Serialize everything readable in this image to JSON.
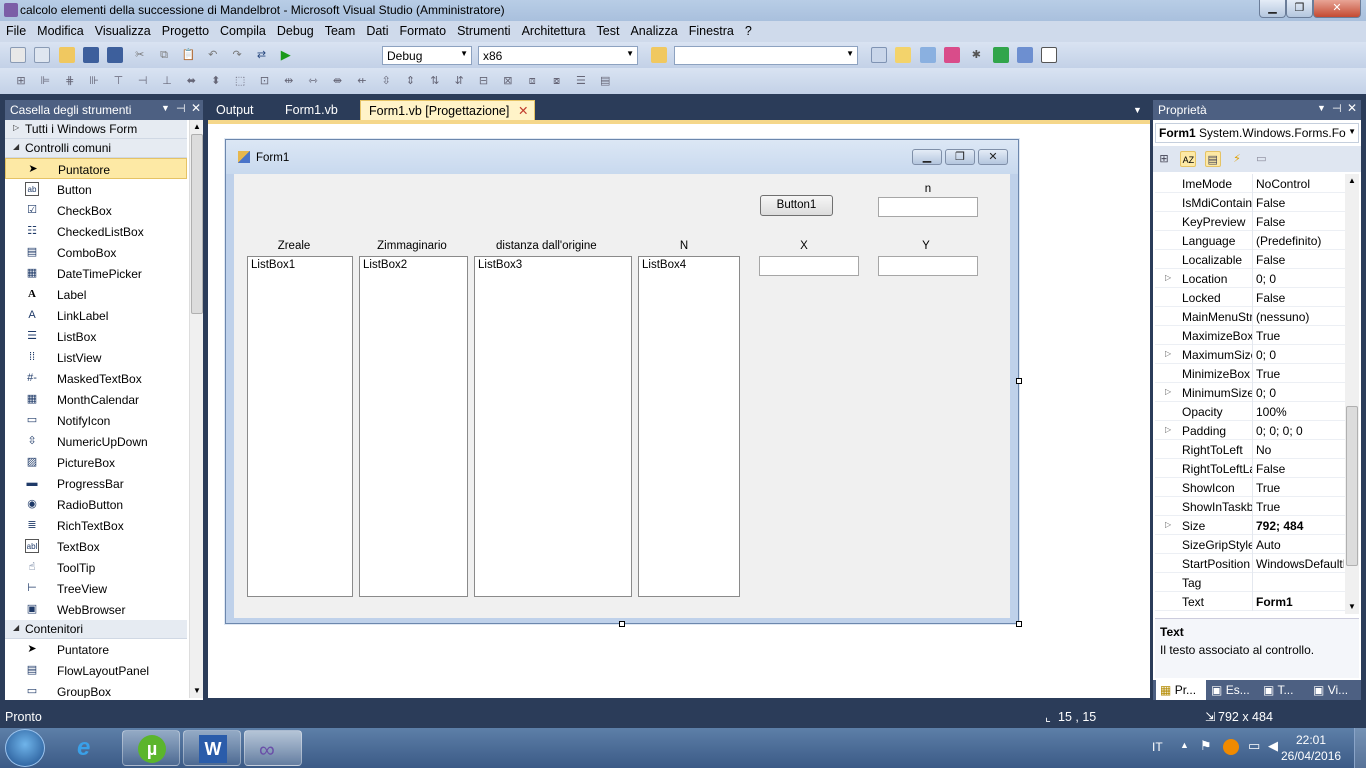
{
  "window": {
    "title": "calcolo elementi della successione di Mandelbrot - Microsoft Visual Studio (Amministratore)"
  },
  "menu": [
    "File",
    "Modifica",
    "Visualizza",
    "Progetto",
    "Compila",
    "Debug",
    "Team",
    "Dati",
    "Formato",
    "Strumenti",
    "Architettura",
    "Test",
    "Analizza",
    "Finestra",
    "?"
  ],
  "toolbar": {
    "config": "Debug",
    "platform": "x86",
    "find": ""
  },
  "toolbox": {
    "title": "Casella degli strumenti",
    "all_forms": "Tutti i Windows Form",
    "common": "Controlli comuni",
    "items": [
      {
        "label": "Puntatore",
        "icon": "pointer-icon"
      },
      {
        "label": "Button",
        "icon": "button-icon"
      },
      {
        "label": "CheckBox",
        "icon": "checkbox-icon"
      },
      {
        "label": "CheckedListBox",
        "icon": "checkedlistbox-icon"
      },
      {
        "label": "ComboBox",
        "icon": "combobox-icon"
      },
      {
        "label": "DateTimePicker",
        "icon": "datetimepicker-icon"
      },
      {
        "label": "Label",
        "icon": "label-icon"
      },
      {
        "label": "LinkLabel",
        "icon": "linklabel-icon"
      },
      {
        "label": "ListBox",
        "icon": "listbox-icon"
      },
      {
        "label": "ListView",
        "icon": "listview-icon"
      },
      {
        "label": "MaskedTextBox",
        "icon": "maskedtextbox-icon"
      },
      {
        "label": "MonthCalendar",
        "icon": "monthcalendar-icon"
      },
      {
        "label": "NotifyIcon",
        "icon": "notifyicon-icon"
      },
      {
        "label": "NumericUpDown",
        "icon": "numericupdown-icon"
      },
      {
        "label": "PictureBox",
        "icon": "picturebox-icon"
      },
      {
        "label": "ProgressBar",
        "icon": "progressbar-icon"
      },
      {
        "label": "RadioButton",
        "icon": "radiobutton-icon"
      },
      {
        "label": "RichTextBox",
        "icon": "richtextbox-icon"
      },
      {
        "label": "TextBox",
        "icon": "textbox-icon"
      },
      {
        "label": "ToolTip",
        "icon": "tooltip-icon"
      },
      {
        "label": "TreeView",
        "icon": "treeview-icon"
      },
      {
        "label": "WebBrowser",
        "icon": "webbrowser-icon"
      }
    ],
    "containers": "Contenitori",
    "container_items": [
      {
        "label": "Puntatore",
        "icon": "pointer-icon"
      },
      {
        "label": "FlowLayoutPanel",
        "icon": "flowlayoutpanel-icon"
      },
      {
        "label": "GroupBox",
        "icon": "groupbox-icon"
      }
    ]
  },
  "tabs": {
    "output": "Output",
    "code": "Form1.vb",
    "design": "Form1.vb [Progettazione]"
  },
  "form": {
    "title": "Form1",
    "button1": "Button1",
    "labels": {
      "n": "n",
      "zreale": "Zreale",
      "zimm": "Zimmaginario",
      "dist": "distanza dall'origine",
      "N": "N",
      "x": "X",
      "y": "Y"
    },
    "listboxes": [
      "ListBox1",
      "ListBox2",
      "ListBox3",
      "ListBox4"
    ]
  },
  "properties": {
    "title": "Proprietà",
    "object_name": "Form1",
    "object_type": "System.Windows.Forms.Fo",
    "rows": [
      {
        "name": "ImeMode",
        "value": "NoControl",
        "expand": false
      },
      {
        "name": "IsMdiContainer",
        "value": "False",
        "expand": false
      },
      {
        "name": "KeyPreview",
        "value": "False",
        "expand": false
      },
      {
        "name": "Language",
        "value": "(Predefinito)",
        "expand": false
      },
      {
        "name": "Localizable",
        "value": "False",
        "expand": false
      },
      {
        "name": "Location",
        "value": "0; 0",
        "expand": true
      },
      {
        "name": "Locked",
        "value": "False",
        "expand": false
      },
      {
        "name": "MainMenuStrip",
        "value": "(nessuno)",
        "expand": false
      },
      {
        "name": "MaximizeBox",
        "value": "True",
        "expand": false
      },
      {
        "name": "MaximumSize",
        "value": "0; 0",
        "expand": true
      },
      {
        "name": "MinimizeBox",
        "value": "True",
        "expand": false
      },
      {
        "name": "MinimumSize",
        "value": "0; 0",
        "expand": true
      },
      {
        "name": "Opacity",
        "value": "100%",
        "expand": false
      },
      {
        "name": "Padding",
        "value": "0; 0; 0; 0",
        "expand": true
      },
      {
        "name": "RightToLeft",
        "value": "No",
        "expand": false
      },
      {
        "name": "RightToLeftLayout",
        "value": "False",
        "expand": false
      },
      {
        "name": "ShowIcon",
        "value": "True",
        "expand": false
      },
      {
        "name": "ShowInTaskbar",
        "value": "True",
        "expand": false
      },
      {
        "name": "Size",
        "value": "792; 484",
        "expand": true,
        "bold": true
      },
      {
        "name": "SizeGripStyle",
        "value": "Auto",
        "expand": false
      },
      {
        "name": "StartPosition",
        "value": "WindowsDefaultLocation",
        "expand": false
      },
      {
        "name": "Tag",
        "value": "",
        "expand": false
      },
      {
        "name": "Text",
        "value": "Form1",
        "expand": false,
        "bold": true
      }
    ],
    "desc_title": "Text",
    "desc_text": "Il testo associato al controllo.",
    "bottom_tabs": [
      "Pr...",
      "Es...",
      "T...",
      "Vi..."
    ]
  },
  "status": {
    "ready": "Pronto",
    "position": "15 , 15",
    "size": "792 x 484"
  },
  "taskbar": {
    "lang": "IT",
    "time": "22:01",
    "date": "26/04/2016"
  }
}
